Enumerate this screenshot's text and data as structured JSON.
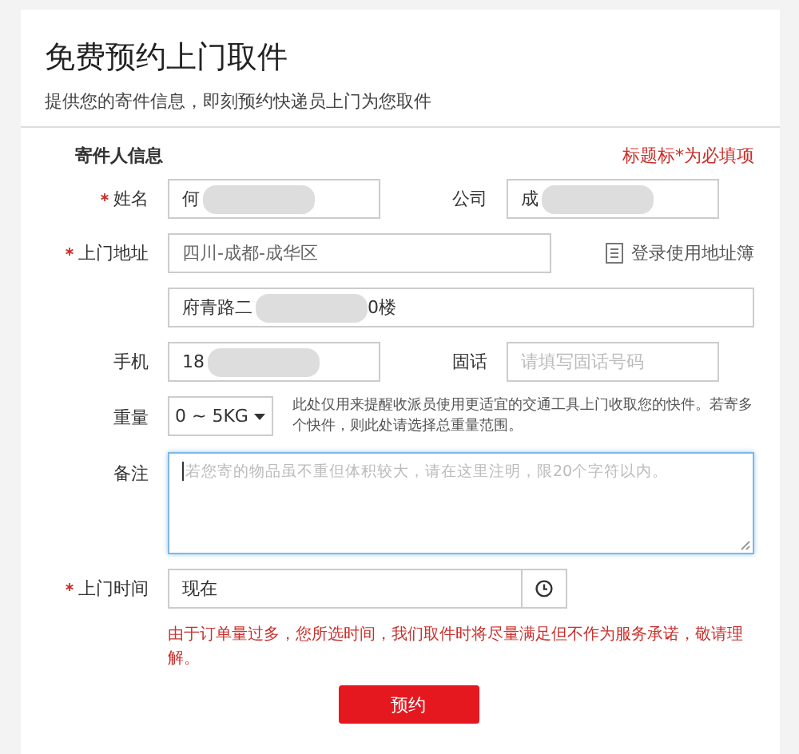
{
  "title": "免费预约上门取件",
  "subtitle": "提供您的寄件信息，即刻预约快递员上门为您取件",
  "section": {
    "title": "寄件人信息",
    "required_note": "标题标*为必填项"
  },
  "rows": [
    {
      "kind": "pair",
      "fields": [
        {
          "label": "姓名",
          "required": true,
          "value": "何",
          "redacted": true
        },
        {
          "label": "公司",
          "required": false,
          "value": "成",
          "redacted": true
        }
      ]
    },
    {
      "kind": "address",
      "label": "上门地址",
      "required": true,
      "region": "四川-成都-成华区",
      "link": "登录使用地址簿",
      "street": "府青路二",
      "redacted": true,
      "street_end": "0楼"
    },
    {
      "kind": "pair",
      "fields": [
        {
          "label": "手机",
          "required": false,
          "value": "18",
          "redacted": true
        },
        {
          "label": "固话",
          "required": false,
          "placeholder": "请填写固话号码",
          "redacted": false
        }
      ]
    },
    {
      "kind": "select",
      "label": "重量",
      "required": false,
      "value": "0 ~ 5KG",
      "hint": "此处仅用来提醒收派员使用更适宜的交通工具上门收取您的快件。若寄多个快件，则此处请选择总重量范围。"
    },
    {
      "kind": "textarea",
      "label": "备注",
      "required": false,
      "placeholder": "若您寄的物品虽不重但体积较大，请在这里注明，限20个字符以内。",
      "focused": true
    },
    {
      "kind": "time",
      "label": "上门时间",
      "required": true,
      "value": "现在",
      "warning": "由于订单量过多，您所选时间，我们取件时将尽量满足但不作为服务承诺，敬请理解。"
    }
  ],
  "submit": "预约"
}
